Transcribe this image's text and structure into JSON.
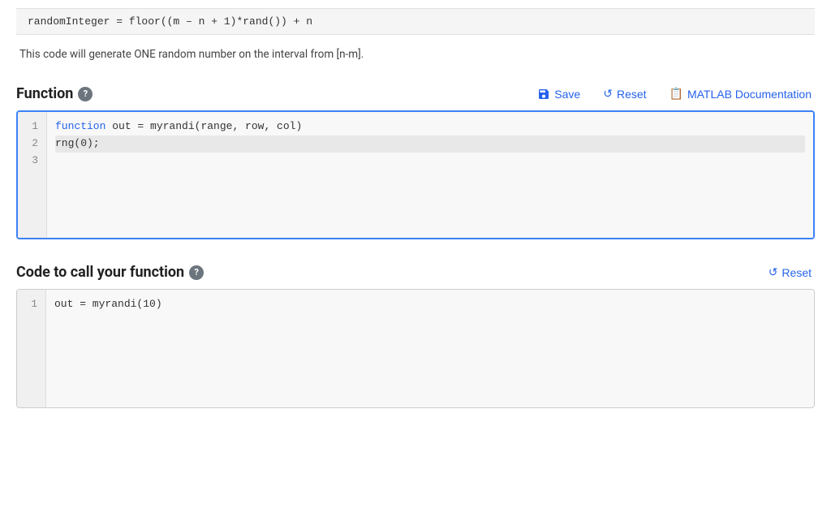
{
  "banner": {
    "code": "randomInteger = floor((m – n + 1)*rand()) + n"
  },
  "description": "This code will generate ONE random number on the interval from [n-m].",
  "function_section": {
    "title": "Function",
    "help_icon": "?",
    "save_label": "Save",
    "reset_label": "Reset",
    "matlab_doc_label": "MATLAB Documentation",
    "code_lines": [
      {
        "number": "1",
        "content_keyword": "function",
        "content_rest": " out = myrandi(range, row, col)",
        "highlighted": false
      },
      {
        "number": "2",
        "content": "rng(0);",
        "highlighted": true
      },
      {
        "number": "3",
        "content": "",
        "highlighted": false
      }
    ]
  },
  "call_section": {
    "title": "Code to call your function",
    "help_icon": "?",
    "reset_label": "Reset",
    "code_lines": [
      {
        "number": "1",
        "content": "out = myrandi(10)",
        "highlighted": false
      }
    ]
  }
}
